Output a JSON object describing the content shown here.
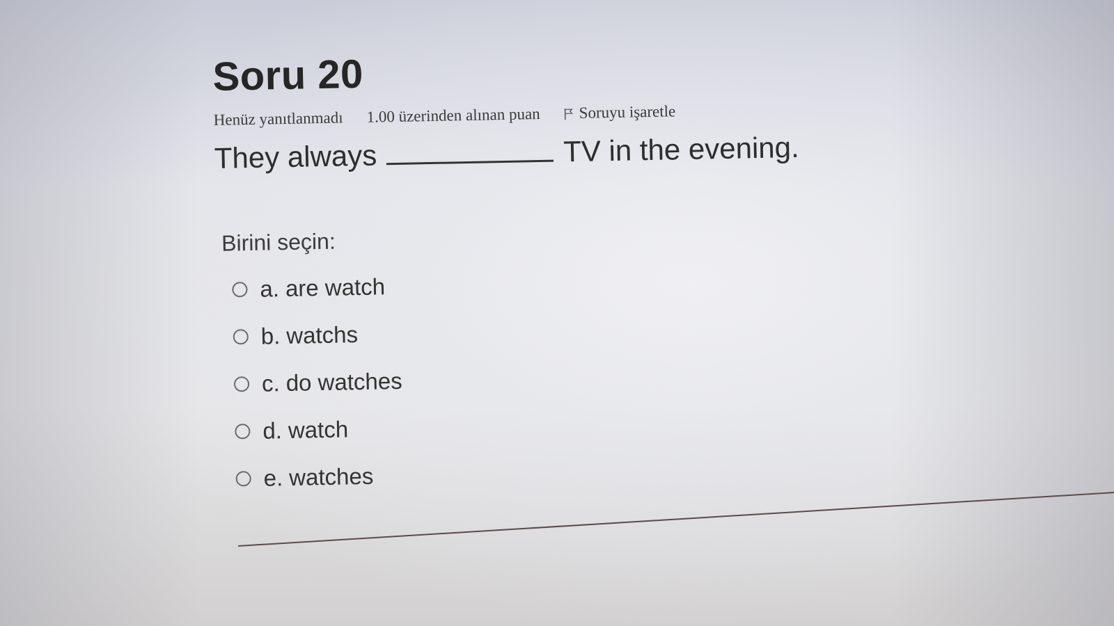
{
  "question": {
    "title": "Soru 20",
    "status": "Henüz yanıtlanmadı",
    "grade": "1.00 üzerinden alınan puan",
    "flag_label": "Soruyu işaretle",
    "text_before": "They always",
    "text_after": "TV in the evening.",
    "prompt": "Birini seçin:",
    "options": [
      {
        "letter": "a.",
        "text": "are watch"
      },
      {
        "letter": "b.",
        "text": "watchs"
      },
      {
        "letter": "c.",
        "text": "do watches"
      },
      {
        "letter": "d.",
        "text": "watch"
      },
      {
        "letter": "e.",
        "text": "watches"
      }
    ]
  },
  "icons": {
    "flag": "flag-icon",
    "radio": "radio-circle"
  }
}
